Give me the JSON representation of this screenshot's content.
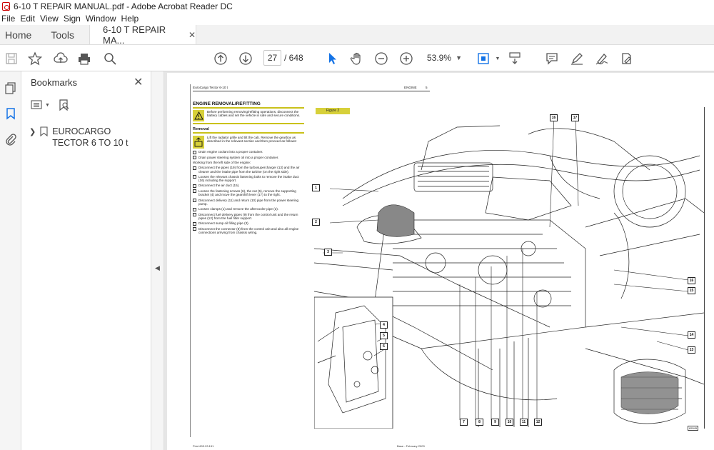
{
  "window": {
    "title": "6-10 T REPAIR MANUAL.pdf - Adobe Acrobat Reader DC"
  },
  "menu": [
    "File",
    "Edit",
    "View",
    "Sign",
    "Window",
    "Help"
  ],
  "tabs": {
    "home": "Home",
    "tools": "Tools",
    "document": "6-10 T REPAIR MA...",
    "document_close": "✕"
  },
  "toolbar": {
    "page_current": "27",
    "page_total": "/  648",
    "zoom": "53.9%"
  },
  "bookmarks": {
    "title": "Bookmarks",
    "close": "✕",
    "items": [
      {
        "label": "EUROCARGO TECTOR 6 TO 10 t"
      }
    ]
  },
  "page": {
    "header_left": "EuroCargo Tector 6-10 t",
    "header_mid": "ENGINE",
    "header_num": "5",
    "section_title": "ENGINE REMOVAL/REFITTING",
    "warning": "Before performing removing/refitting operations, disconnect the battery cables and set the vehicle in safe and secure conditions.",
    "removal_title": "Removal",
    "tool_step": "Lift the radiator grille and tilt the cab. Remove the gearbox as described in the relevant section and then proceed as follows:",
    "steps_a": [
      "Drain engine coolant into a proper container.",
      "Drain power steering system oil into a proper container."
    ],
    "working_note": "Working from the left side of the engine:",
    "steps_b": [
      "Disconnect the pipes (19) from the turbosupercharger (13) and the air cleaner and the intake pipe from the turbine (on the right side).",
      "Loosen the relevant chassis fastening bolts to remove the intake duct (16) including the support.",
      "Disconnect the air duct (15).",
      "Loosen the fastening screws (6), the nut (5), remove the supporting bracket (4) and move the gearshift lever (17) to the right.",
      "Disconnect delivery (11) and return (10) pipe from the power steering pump.",
      "Loosen clamps (1) and remove the aftercooler pipe (2).",
      "Disconnect fuel delivery pipes (9) from the control unit and the return pipes (12) from the fuel filter support.",
      "Disconnect sump oil filling pipe (3).",
      "Disconnect the connector (8) from the control unit and also all engine connections arriving from chassis wiring."
    ],
    "figure_label": "Figure 2",
    "figure_code": "65545",
    "callouts": [
      "16",
      "17",
      "1",
      "2",
      "3",
      "4",
      "5",
      "6",
      "7",
      "8",
      "9",
      "10",
      "11",
      "12",
      "16",
      "15",
      "14",
      "13"
    ],
    "footer_left": "Print 603.93.151",
    "footer_right": "Base - February 2003"
  },
  "colors": {
    "accent_yellow": "#d7d03a",
    "toolbar_blue": "#1473e6"
  }
}
